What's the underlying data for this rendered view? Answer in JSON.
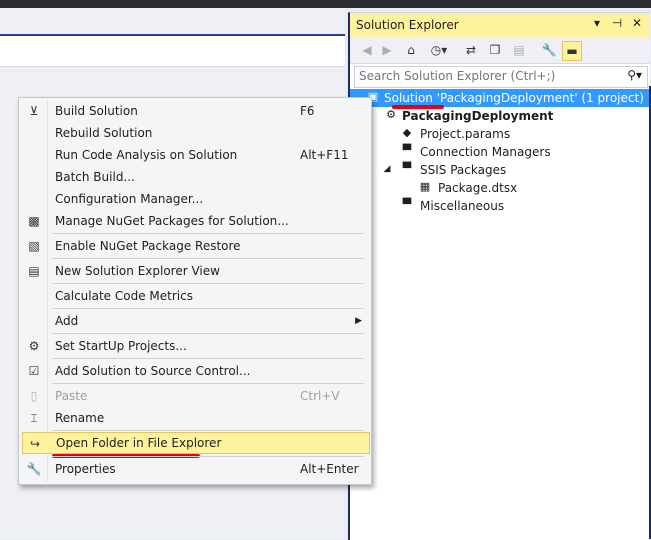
{
  "solution_explorer": {
    "title": "Solution Explorer",
    "title_icons": [
      "dropdown-arrow-icon",
      "pin-icon",
      "close-icon"
    ],
    "search_placeholder": "Search Solution Explorer (Ctrl+;)",
    "toolbar_icons": [
      "back-icon",
      "forward-icon",
      "home-icon",
      "history-icon",
      "sync-icon",
      "show-all-files-icon",
      "collapse-all-icon",
      "properties-icon",
      "preview-icon"
    ],
    "tree": [
      {
        "label": "Solution 'PackagingDeployment' (1 project)",
        "icon": "solution-icon",
        "selected": true
      },
      {
        "label": "PackagingDeployment",
        "icon": "project-icon",
        "bold": true
      },
      {
        "label": "Project.params",
        "icon": "params-icon"
      },
      {
        "label": "Connection Managers",
        "icon": "folder-icon"
      },
      {
        "label": "SSIS Packages",
        "icon": "folder-icon",
        "expanded": true
      },
      {
        "label": "Package.dtsx",
        "icon": "package-icon"
      },
      {
        "label": "Miscellaneous",
        "icon": "folder-icon"
      }
    ]
  },
  "context_menu": {
    "items": [
      {
        "label": "Build Solution",
        "shortcut": "F6",
        "icon": "build-icon"
      },
      {
        "label": "Rebuild Solution",
        "shortcut": ""
      },
      {
        "label": "Run Code Analysis on Solution",
        "shortcut": "Alt+F11"
      },
      {
        "label": "Batch Build...",
        "shortcut": ""
      },
      {
        "label": "Configuration Manager...",
        "shortcut": ""
      },
      {
        "label": "Manage NuGet Packages for Solution...",
        "shortcut": "",
        "icon": "nuget-icon"
      },
      {
        "label": "Enable NuGet Package Restore",
        "shortcut": "",
        "icon": "package-restore-icon"
      },
      {
        "label": "New Solution Explorer View",
        "shortcut": "",
        "icon": "new-view-icon"
      },
      {
        "label": "Calculate Code Metrics",
        "shortcut": ""
      },
      {
        "label": "Add",
        "shortcut": "",
        "submenu": true
      },
      {
        "label": "Set StartUp Projects...",
        "shortcut": "",
        "icon": "gear-icon"
      },
      {
        "label": "Add Solution to Source Control...",
        "shortcut": "",
        "icon": "source-control-icon"
      },
      {
        "label": "Paste",
        "shortcut": "Ctrl+V",
        "icon": "paste-icon",
        "disabled": true
      },
      {
        "label": "Rename",
        "shortcut": "",
        "icon": "rename-icon"
      },
      {
        "label": "Open Folder in File Explorer",
        "shortcut": "",
        "icon": "open-folder-icon",
        "highlighted": true
      },
      {
        "label": "Properties",
        "shortcut": "Alt+Enter",
        "icon": "wrench-icon"
      }
    ]
  },
  "colors": {
    "selection": "#3399ff",
    "highlight": "#fff29d",
    "annotation_red": "#e4000f"
  }
}
